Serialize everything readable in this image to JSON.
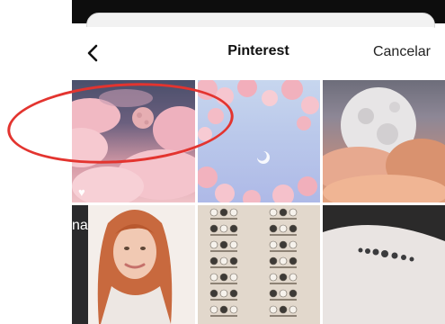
{
  "header": {
    "title": "Pinterest",
    "cancel_label": "Cancelar"
  },
  "icons": {
    "back": "chevron-left-icon",
    "favorite": "heart-icon"
  },
  "tiles": [
    {
      "subject": "pink clouds with full moon",
      "favorite": true
    },
    {
      "subject": "cherry blossoms with crescent moon"
    },
    {
      "subject": "full moon over sunset clouds"
    },
    {
      "subject": "woman with long copper hair",
      "text": "na"
    },
    {
      "subject": "moon phase calendar"
    },
    {
      "subject": "moon phases tattoo on arm"
    }
  ],
  "colors": {
    "annotation": "#e3342f",
    "backdrop": "#0d0d0d",
    "heart": "#ffffff"
  }
}
